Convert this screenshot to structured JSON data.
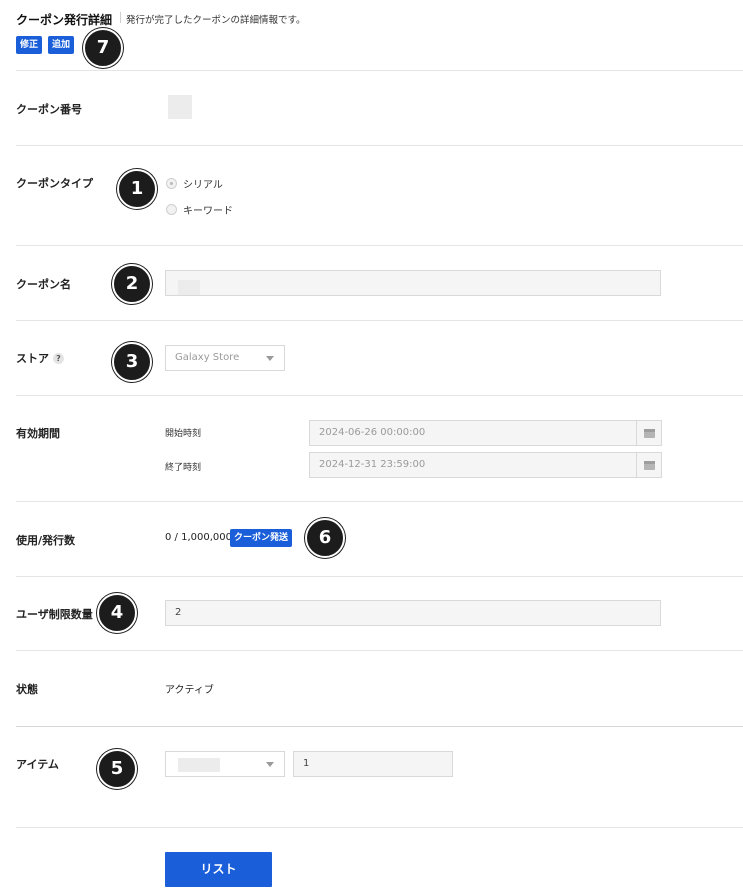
{
  "header": {
    "title": "クーポン発行詳細",
    "subtitle": "発行が完了したクーポンの詳細情報です。",
    "edit_label": "修正",
    "add_label": "追加"
  },
  "badges": {
    "b1": "1",
    "b2": "2",
    "b3": "3",
    "b4": "4",
    "b5": "5",
    "b6": "6",
    "b7": "7"
  },
  "coupon_number": {
    "label": "クーポン番号"
  },
  "coupon_type": {
    "label": "クーポンタイプ",
    "options": [
      "シリアル",
      "キーワード"
    ],
    "selected": "シリアル"
  },
  "coupon_name": {
    "label": "クーポン名"
  },
  "store": {
    "label": "ストア",
    "help": "?",
    "selected": "Galaxy Store"
  },
  "validity": {
    "label": "有効期間",
    "start_label": "開始時刻",
    "start_value": "2024-06-26 00:00:00",
    "end_label": "終了時刻",
    "end_value": "2024-12-31 23:59:00"
  },
  "usage": {
    "label": "使用/発行数",
    "value": "0 / 1,000,000",
    "issue_button": "クーポン発送"
  },
  "user_limit": {
    "label": "ユーザ制限数量",
    "value": "2"
  },
  "status": {
    "label": "状態",
    "value": "アクティブ"
  },
  "item": {
    "label": "アイテム",
    "quantity": "1"
  },
  "footer": {
    "list_button": "リスト"
  },
  "colors": {
    "accent": "#1a5fd9",
    "badge": "#1c1c1c"
  }
}
